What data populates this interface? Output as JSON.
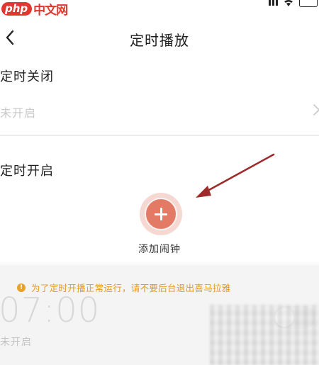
{
  "status_bar": {
    "brand_php": "php",
    "brand_cn": "中文网",
    "icons": [
      "signal-icon",
      "wifi-icon",
      "battery-icon"
    ]
  },
  "nav": {
    "title": "定时播放",
    "back_icon": "chevron-left-icon"
  },
  "timer_close": {
    "title": "定时关闭",
    "value": "未开启",
    "chevron_icon": "chevron-right-icon"
  },
  "timer_open": {
    "title": "定时开启",
    "add_alarm_label": "添加闹钟",
    "add_icon": "plus-icon"
  },
  "notice": {
    "icon": "info-icon",
    "text": "为了定时开播正常运行，请不要后台退出喜马拉雅"
  },
  "alarm": {
    "time": "07:00",
    "status": "未开启",
    "enabled": false
  },
  "colors": {
    "accent": "#e37a66",
    "accent_light": "#f6d8d3",
    "notice": "#e59a1e",
    "arrow": "#9e2b2b",
    "brand_red": "#e2362e"
  }
}
